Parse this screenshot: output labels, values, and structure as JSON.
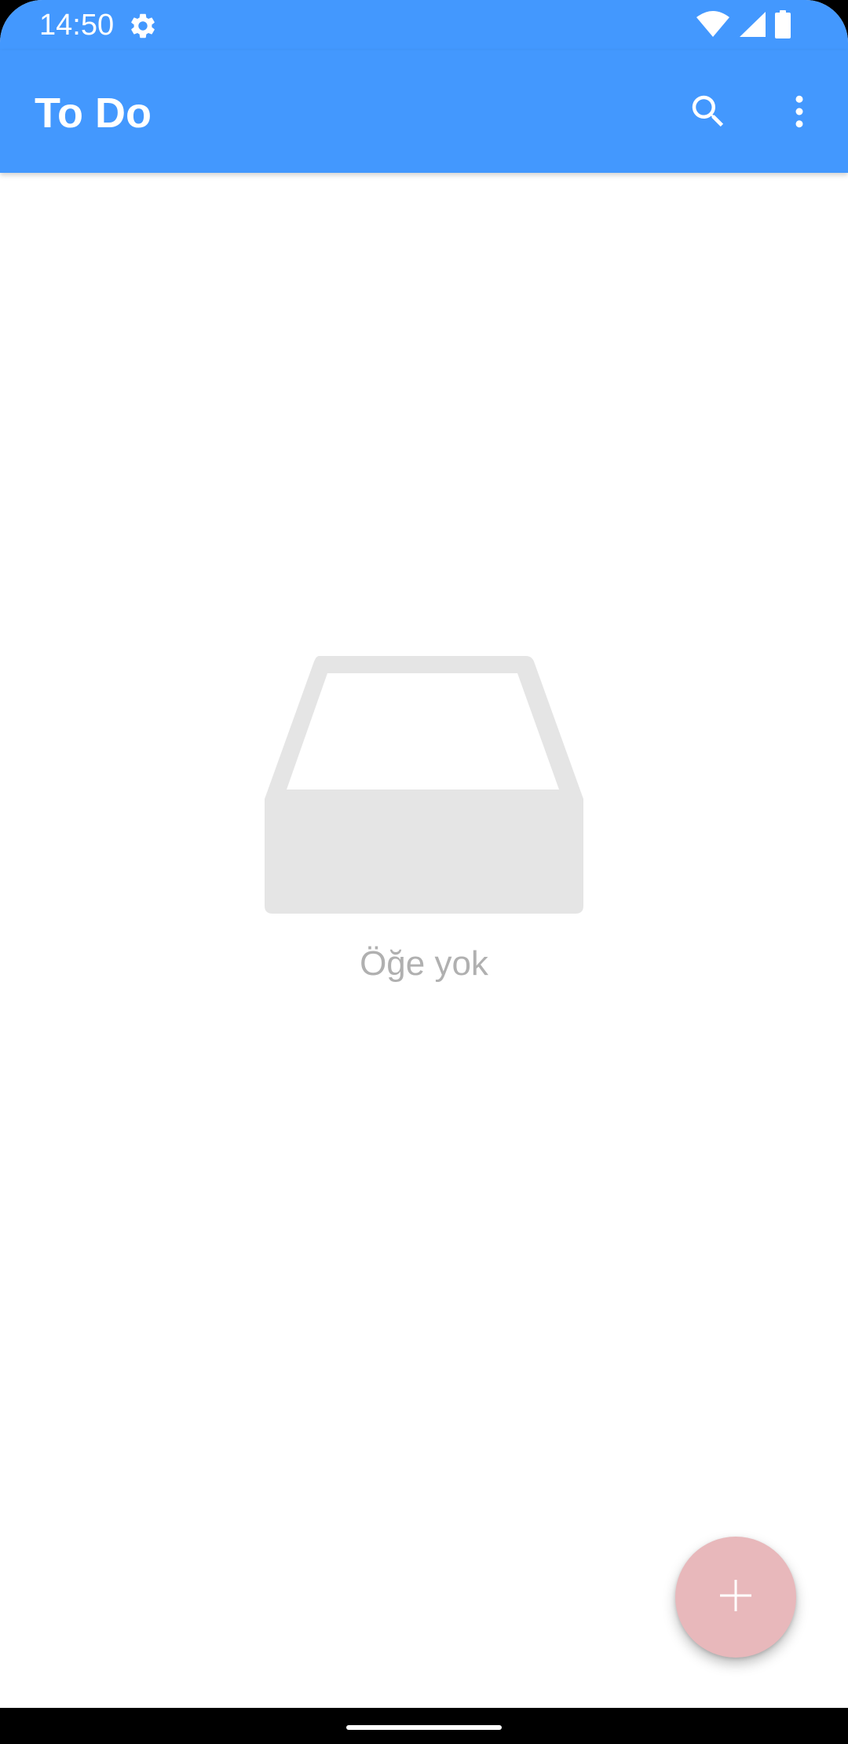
{
  "status_bar": {
    "time": "14:50",
    "icons": [
      "settings-icon",
      "wifi-icon",
      "cellular-signal-icon",
      "battery-icon"
    ]
  },
  "app_bar": {
    "title": "To Do",
    "actions": [
      "search-icon",
      "more-vert-icon"
    ]
  },
  "empty_state": {
    "icon": "empty-inbox-tray-icon",
    "message": "Öğe yok"
  },
  "fab": {
    "icon": "plus-icon"
  },
  "colors": {
    "primary": "#4398fe",
    "fab": "#e8b8bb",
    "empty_icon": "#e5e5e5",
    "empty_text": "#b0b0b0"
  }
}
